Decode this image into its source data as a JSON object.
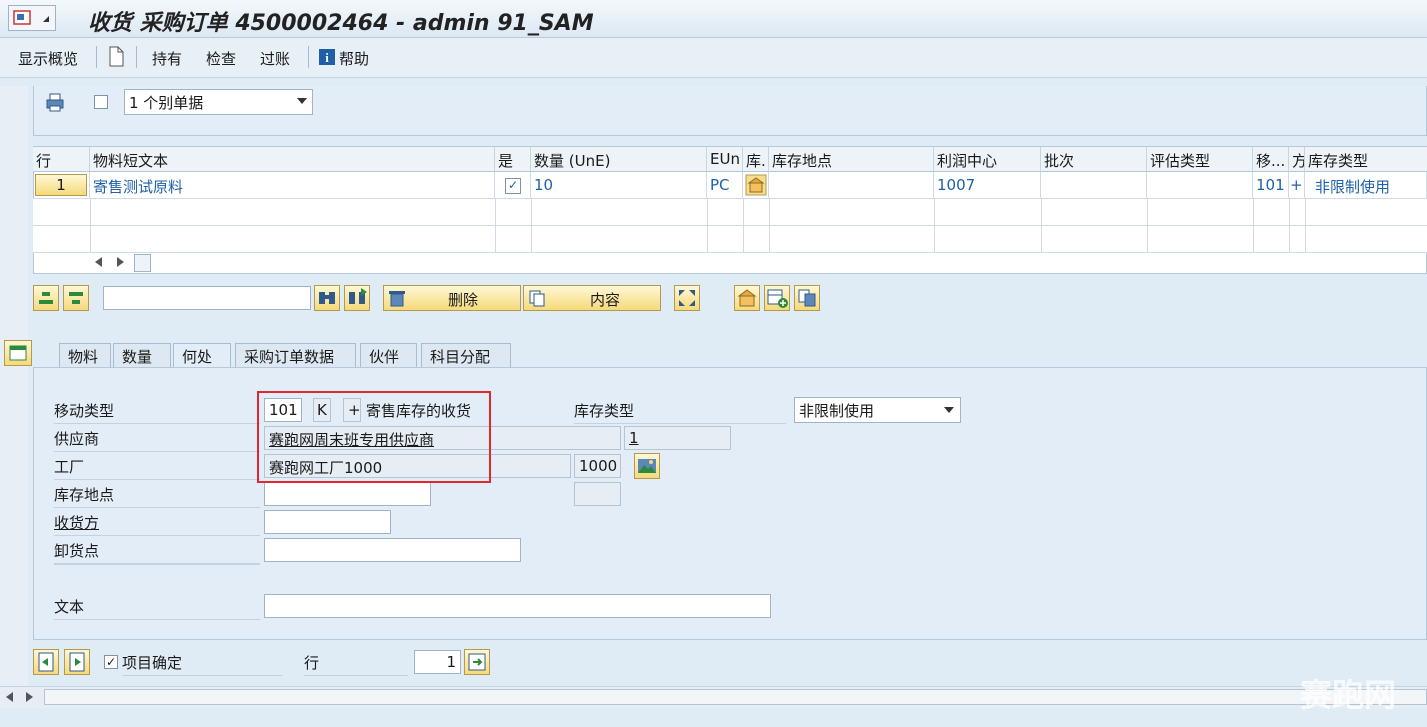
{
  "title": "收货 采购订单 4500002464 - admin 91_SAM",
  "menu": {
    "overview": "显示概览",
    "hold": "持有",
    "check": "检查",
    "post": "过账",
    "help": "帮助"
  },
  "header": {
    "doc_select": "1 个别单据"
  },
  "table": {
    "columns": [
      "行",
      "物料短文本",
      "是",
      "数量 (UnE)",
      "EUn",
      "库.",
      "库存地点",
      "利润中心",
      "批次",
      "评估类型",
      "移...",
      "方",
      "库存类型"
    ],
    "rows": [
      {
        "line": "1",
        "material": "寄售测试原料",
        "ok": "✓",
        "qty": "10",
        "unit": "PC",
        "profit_center": "1007",
        "mvt": "101",
        "dir": "+",
        "stock_type": "非限制使用"
      }
    ]
  },
  "toolbar2": {
    "delete_label": "删除",
    "content_label": "内容",
    "search_value": ""
  },
  "tabs": [
    "物料",
    "数量",
    "何处",
    "采购订单数据",
    "伙伴",
    "科目分配"
  ],
  "detail": {
    "movement_type_label": "移动类型",
    "movement_type": "101",
    "movement_special": "K",
    "movement_sign": "+",
    "movement_desc": "寄售库存的收货",
    "stock_type_label": "库存类型",
    "stock_type_value": "非限制使用",
    "vendor_label": "供应商",
    "vendor_name": "赛跑网周末班专用供应商",
    "vendor_code": "1",
    "plant_label": "工厂",
    "plant_name": "赛跑网工厂1000",
    "plant_code": "1000",
    "storage_label": "库存地点",
    "storage_value": "",
    "recipient_label": "收货方",
    "recipient_value": "",
    "unloading_label": "卸货点",
    "unloading_value": "",
    "text_label": "文本",
    "text_value": ""
  },
  "footer": {
    "item_ok_label": "项目确定",
    "item_ok": "✓",
    "line_label": "行",
    "line_value": "1"
  },
  "watermark": "赛跑网",
  "colors": {
    "highlight_box": "#e0282e",
    "link_blue": "#1f5fa8"
  }
}
